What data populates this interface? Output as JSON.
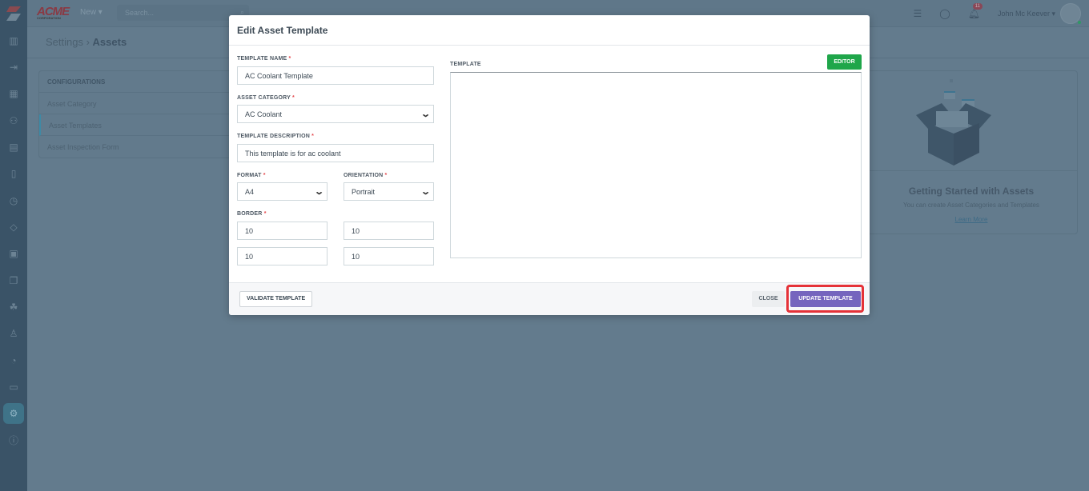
{
  "app": {
    "logo_text": "ACME",
    "logo_sub": "CORPORATION",
    "new_label": "New",
    "search_placeholder": "Search...",
    "user_name": "John Mc Keever",
    "notification_count": "11"
  },
  "breadcrumb": {
    "parent": "Settings",
    "current": "Assets"
  },
  "config": {
    "header": "CONFIGURATIONS",
    "items": [
      "Asset Category",
      "Asset Templates",
      "Asset Inspection Form"
    ]
  },
  "getting_started": {
    "title": "Getting Started with Assets",
    "subtitle": "You can create Asset Categories and Templates",
    "link": "Learn More"
  },
  "modal": {
    "title": "Edit Asset Template",
    "template_name_label": "TEMPLATE NAME",
    "template_name": "AC Coolant Template",
    "asset_category_label": "ASSET CATEGORY",
    "asset_category": "AC Coolant",
    "description_label": "TEMPLATE DESCRIPTION",
    "description": "This template is for ac coolant",
    "format_label": "FORMAT",
    "format": "A4",
    "orientation_label": "ORIENTATION",
    "orientation": "Portrait",
    "border_label": "BORDER",
    "borders": [
      "10",
      "10",
      "10",
      "10"
    ],
    "template_label": "TEMPLATE",
    "editor_label": "EDITOR",
    "validate_label": "VALIDATE TEMPLATE",
    "close_label": "CLOSE",
    "update_label": "UPDATE TEMPLATE",
    "required_mark": "*"
  }
}
